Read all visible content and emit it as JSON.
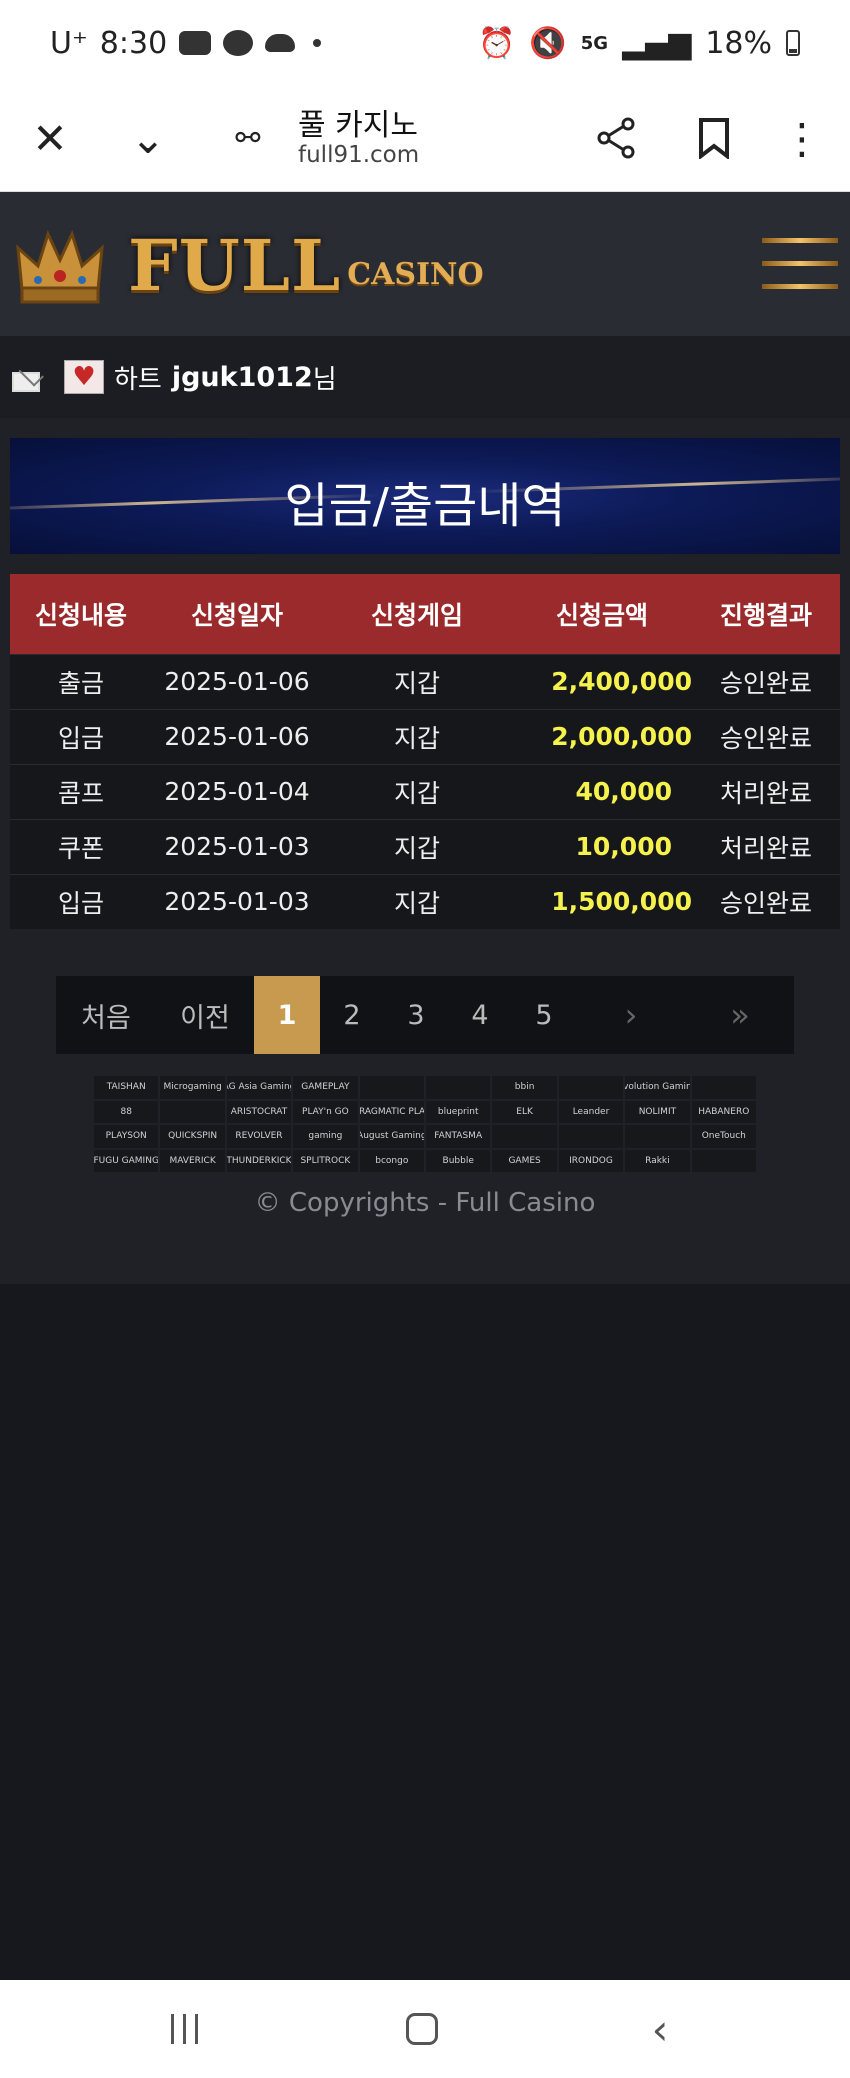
{
  "status_bar": {
    "carrier": "U⁺",
    "time": "8:30",
    "network": "5G",
    "battery": "18%"
  },
  "browser": {
    "page_title": "풀 카지노",
    "url": "full91.com"
  },
  "site": {
    "logo_main": "FULL",
    "logo_sub": "CASINO"
  },
  "user": {
    "level": "하트",
    "id": "jguk1012",
    "suffix": "님"
  },
  "page_heading": "입금/출금내역",
  "table": {
    "headers": [
      "신청내용",
      "신청일자",
      "신청게임",
      "신청금액",
      "진행결과"
    ],
    "rows": [
      {
        "type": "출금",
        "date": "2025-01-06",
        "game": "지갑",
        "amount": "2,400,000",
        "result": "승인완료"
      },
      {
        "type": "입금",
        "date": "2025-01-06",
        "game": "지갑",
        "amount": "2,000,000",
        "result": "승인완료"
      },
      {
        "type": "콤프",
        "date": "2025-01-04",
        "game": "지갑",
        "amount": "40,000",
        "result": "처리완료"
      },
      {
        "type": "쿠폰",
        "date": "2025-01-03",
        "game": "지갑",
        "amount": "10,000",
        "result": "처리완료"
      },
      {
        "type": "입금",
        "date": "2025-01-03",
        "game": "지갑",
        "amount": "1,500,000",
        "result": "승인완료"
      }
    ]
  },
  "pagination": {
    "first": "처음",
    "prev": "이전",
    "pages": [
      "1",
      "2",
      "3",
      "4",
      "5"
    ],
    "current": "1",
    "next": "›",
    "last": "»"
  },
  "providers": [
    "TAISHAN",
    "Microgaming",
    "AG Asia Gaming",
    "GAMEPLAY",
    "",
    "",
    "bbin",
    "",
    "Evolution Gaming",
    "",
    "88",
    "",
    "ARISTOCRAT",
    "PLAY'n GO",
    "PRAGMATIC PLAY",
    "blueprint",
    "ELK",
    "Leander",
    "NOLIMIT",
    "HABANERO",
    "PLAYSON",
    "QUICKSPIN",
    "REVOLVER",
    "gaming",
    "August Gaming",
    "FANTASMA",
    "",
    "",
    "",
    "OneTouch",
    "FUGU GAMING",
    "MAVERICK",
    "THUNDERKICK",
    "SPLITROCK",
    "bcongo",
    "Bubble",
    "GAMES",
    "IRONDOG",
    "Rakki",
    ""
  ],
  "copyright": "© Copyrights - Full Casino"
}
